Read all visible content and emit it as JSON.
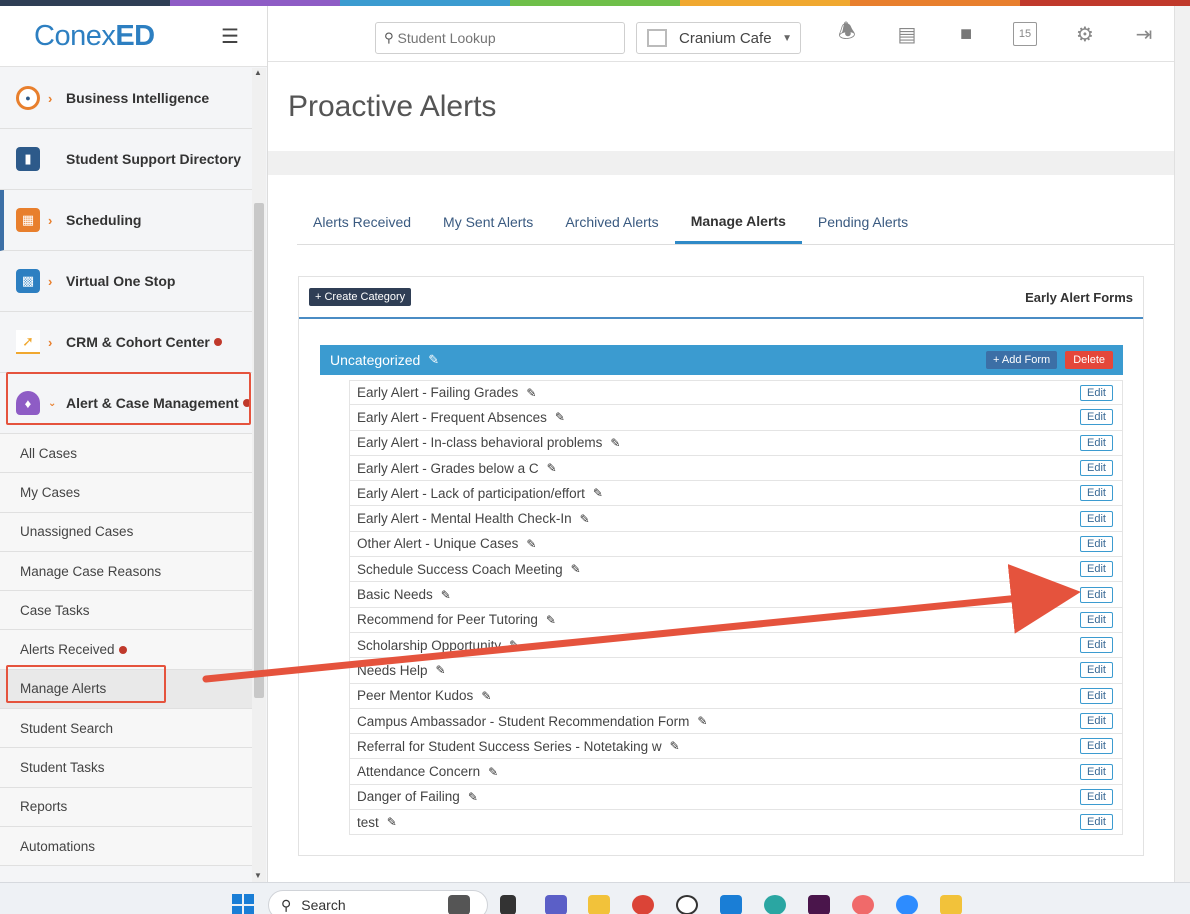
{
  "brand": {
    "logo_a": "Conex",
    "logo_b": "ED",
    "menu_icon": "hamburger-icon"
  },
  "header": {
    "search_placeholder": "Student Lookup",
    "campus": "Cranium Cafe",
    "icons": [
      "bell-icon",
      "contact-card-icon",
      "lock-icon",
      "calendar-icon",
      "gear-icon",
      "logout-icon"
    ]
  },
  "sidebar": {
    "items": [
      {
        "label": "Business Intelligence",
        "icon": "analytics-icon",
        "color": "#e87f2d"
      },
      {
        "label": "Student Support Directory",
        "icon": "directory-icon",
        "color": "#2d5a8a"
      },
      {
        "label": "Scheduling",
        "icon": "calendar-icon",
        "color": "#e87f2d"
      },
      {
        "label": "Virtual One Stop",
        "icon": "people-icon",
        "color": "#2d7fc1"
      },
      {
        "label": "CRM & Cohort Center",
        "icon": "chart-icon",
        "color": "#f0a830"
      },
      {
        "label": "Alert & Case Management",
        "icon": "bell-icon",
        "color": "#8e5cc5"
      }
    ],
    "subitems": [
      "All Cases",
      "My Cases",
      "Unassigned Cases",
      "Manage Case Reasons",
      "Case Tasks",
      "Alerts Received",
      "Manage Alerts",
      "Student Search",
      "Student Tasks",
      "Reports",
      "Automations"
    ]
  },
  "page": {
    "title": "Proactive Alerts"
  },
  "tabs": [
    "Alerts Received",
    "My Sent Alerts",
    "Archived Alerts",
    "Manage Alerts",
    "Pending Alerts"
  ],
  "panel": {
    "create_label": "+ Create Category",
    "title": "Early Alert Forms",
    "category": "Uncategorized",
    "add_form_label": "+ Add Form",
    "delete_label": "Delete",
    "edit_label": "Edit",
    "forms": [
      "Early Alert - Failing Grades",
      "Early Alert - Frequent Absences",
      "Early Alert - In-class behavioral problems",
      "Early Alert - Grades below a C",
      "Early Alert - Lack of participation/effort",
      "Early Alert - Mental Health Check-In",
      "Other Alert - Unique Cases",
      "Schedule Success Coach Meeting",
      "Basic Needs",
      "Recommend for Peer Tutoring",
      "Scholarship Opportunity",
      "Needs Help",
      "Peer Mentor Kudos",
      "Campus Ambassador - Student Recommendation Form",
      "Referral for Student Success Series - Notetaking w",
      "Attendance Concern",
      "Danger of Failing",
      "test"
    ]
  },
  "taskbar": {
    "search_label": "Search"
  },
  "colors": {
    "accent": "#3b9bd0",
    "delete": "#e4473a",
    "highlight": "#e5533d",
    "dark_button": "#2f3e55"
  }
}
